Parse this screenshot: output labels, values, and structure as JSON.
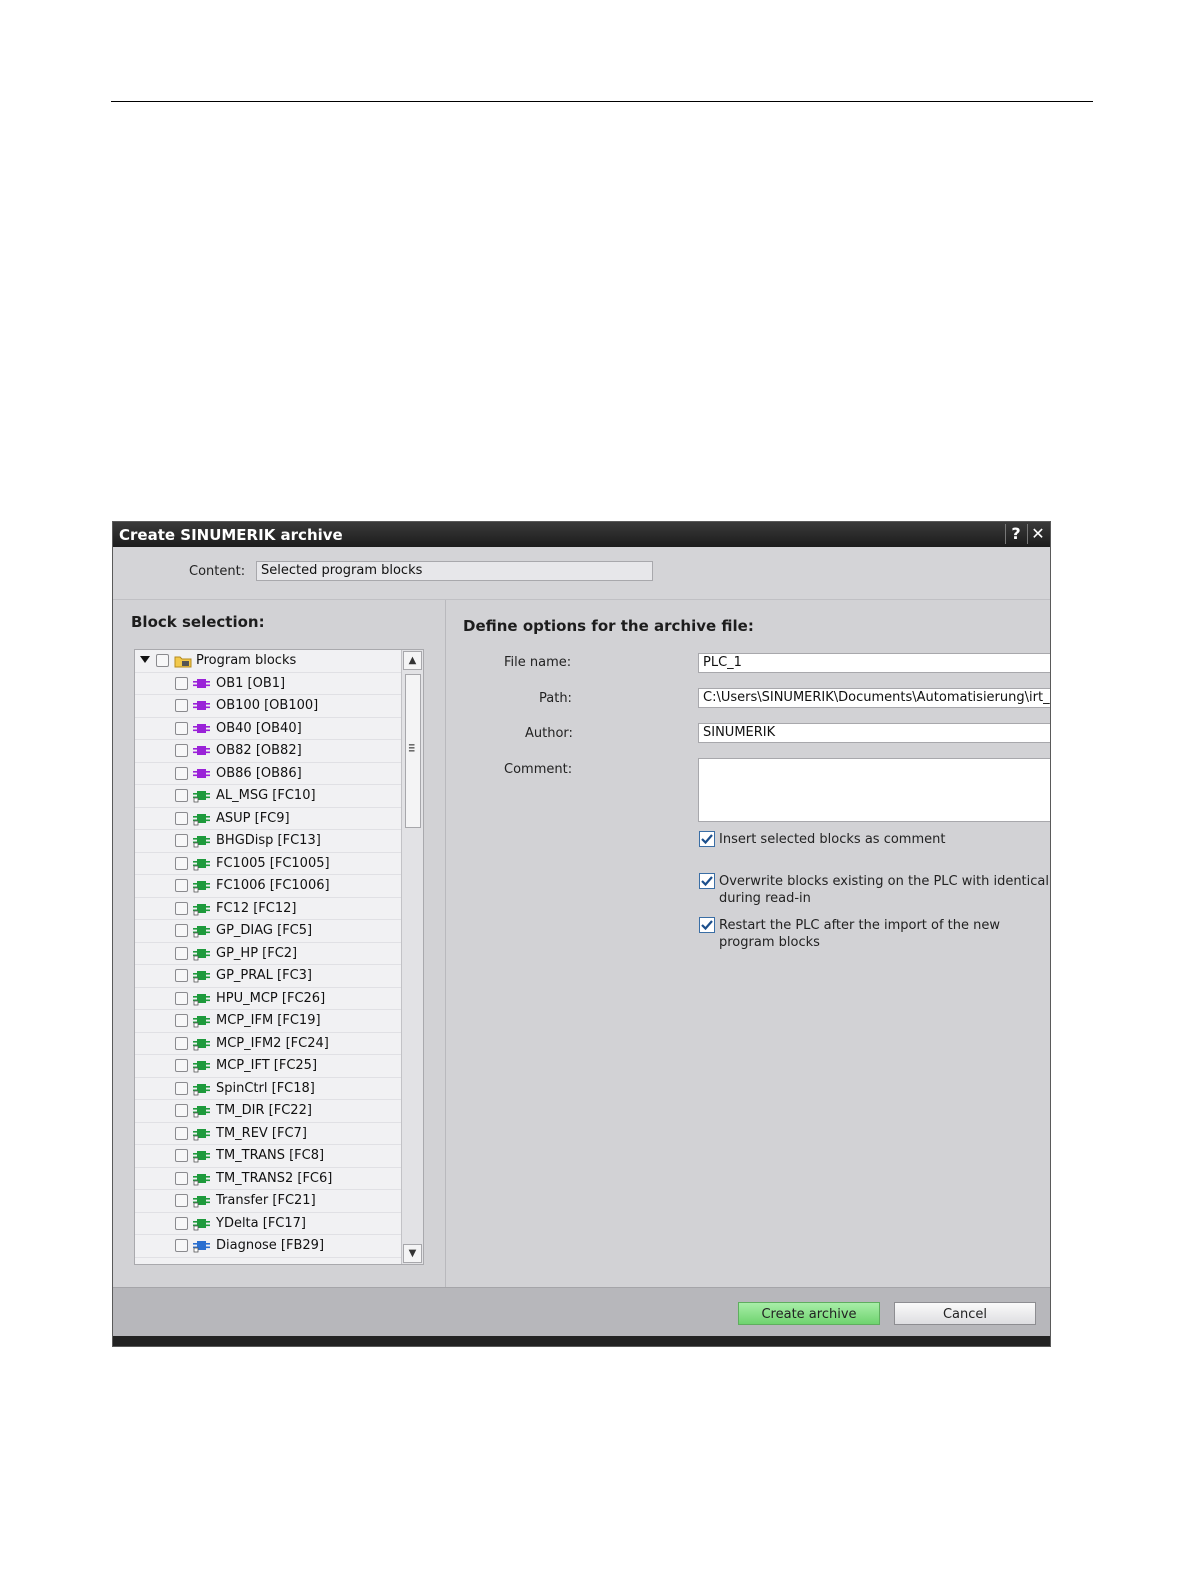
{
  "dialog": {
    "title": "Create SINUMERIK archive",
    "help_label": "?",
    "close_label": "✕",
    "content_label": "Content:",
    "content_value": "Selected program blocks"
  },
  "block_selection": {
    "title": "Block selection:",
    "root": {
      "label": "Program blocks",
      "icon": "folder-icon"
    },
    "items": [
      {
        "label": "OB1 [OB1]",
        "type": "OB"
      },
      {
        "label": "OB100 [OB100]",
        "type": "OB"
      },
      {
        "label": "OB40 [OB40]",
        "type": "OB"
      },
      {
        "label": "OB82 [OB82]",
        "type": "OB"
      },
      {
        "label": "OB86 [OB86]",
        "type": "OB"
      },
      {
        "label": "AL_MSG [FC10]",
        "type": "FC"
      },
      {
        "label": "ASUP [FC9]",
        "type": "FC"
      },
      {
        "label": "BHGDisp [FC13]",
        "type": "FC"
      },
      {
        "label": "FC1005 [FC1005]",
        "type": "FC"
      },
      {
        "label": "FC1006 [FC1006]",
        "type": "FC"
      },
      {
        "label": "FC12 [FC12]",
        "type": "FC"
      },
      {
        "label": "GP_DIAG [FC5]",
        "type": "FC"
      },
      {
        "label": "GP_HP [FC2]",
        "type": "FC"
      },
      {
        "label": "GP_PRAL [FC3]",
        "type": "FC"
      },
      {
        "label": "HPU_MCP [FC26]",
        "type": "FC"
      },
      {
        "label": "MCP_IFM [FC19]",
        "type": "FC"
      },
      {
        "label": "MCP_IFM2 [FC24]",
        "type": "FC"
      },
      {
        "label": "MCP_IFT [FC25]",
        "type": "FC"
      },
      {
        "label": "SpinCtrl [FC18]",
        "type": "FC"
      },
      {
        "label": "TM_DIR [FC22]",
        "type": "FC"
      },
      {
        "label": "TM_REV [FC7]",
        "type": "FC"
      },
      {
        "label": "TM_TRANS [FC8]",
        "type": "FC"
      },
      {
        "label": "TM_TRANS2 [FC6]",
        "type": "FC"
      },
      {
        "label": "Transfer [FC21]",
        "type": "FC"
      },
      {
        "label": "YDelta [FC17]",
        "type": "FC"
      },
      {
        "label": "Diagnose [FB29]",
        "type": "FB"
      }
    ],
    "icon_colors": {
      "OB": "#9a22d8",
      "FC": "#1e9a3c",
      "FB": "#2a6fd0"
    }
  },
  "options": {
    "title": "Define options for the archive file:",
    "file_name_label": "File name:",
    "file_name_value": "PLC_1",
    "path_label": "Path:",
    "path_value": "C:\\Users\\SINUMERIK\\Documents\\Automatisierung\\irt_per\\Archives",
    "browse_label": "...",
    "author_label": "Author:",
    "author_value": "SINUMERIK",
    "comment_label": "Comment:",
    "comment_value": "",
    "checkboxes": [
      {
        "label": "Insert selected blocks as comment",
        "checked": true
      },
      {
        "label": "Overwrite blocks existing on the PLC with identical numbers during read-in",
        "checked": true
      },
      {
        "label": "Restart the PLC after the import of the new program blocks",
        "checked": true
      }
    ]
  },
  "footer": {
    "create_label": "Create archive",
    "cancel_label": "Cancel",
    "create_color": "#7ddc7d"
  }
}
